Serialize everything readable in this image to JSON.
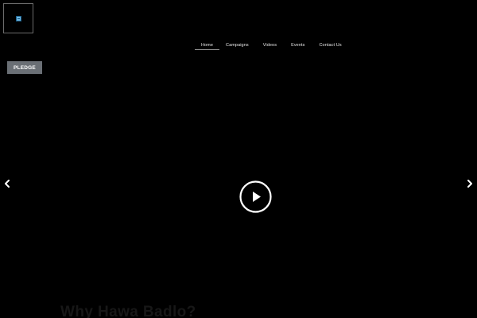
{
  "header": {
    "logo_icon": "site-logo-icon"
  },
  "nav": {
    "items": [
      {
        "label": "Home",
        "active": true
      },
      {
        "label": "Campaigns"
      },
      {
        "label": "Videos"
      },
      {
        "label": "Events"
      },
      {
        "label": "Contact Us"
      }
    ]
  },
  "hero": {
    "pledge_label": "PLEDGE",
    "prev_icon": "chevron-left-icon",
    "next_icon": "chevron-right-icon",
    "play_icon": "play-icon"
  },
  "section": {
    "title": "Why Hawa Badlo?"
  },
  "colors": {
    "background": "#000000",
    "pledge_button": "#6a6f75",
    "nav_text": "#e6e6e6",
    "active_underline": "#9a9a9a",
    "section_title": "#171717"
  }
}
